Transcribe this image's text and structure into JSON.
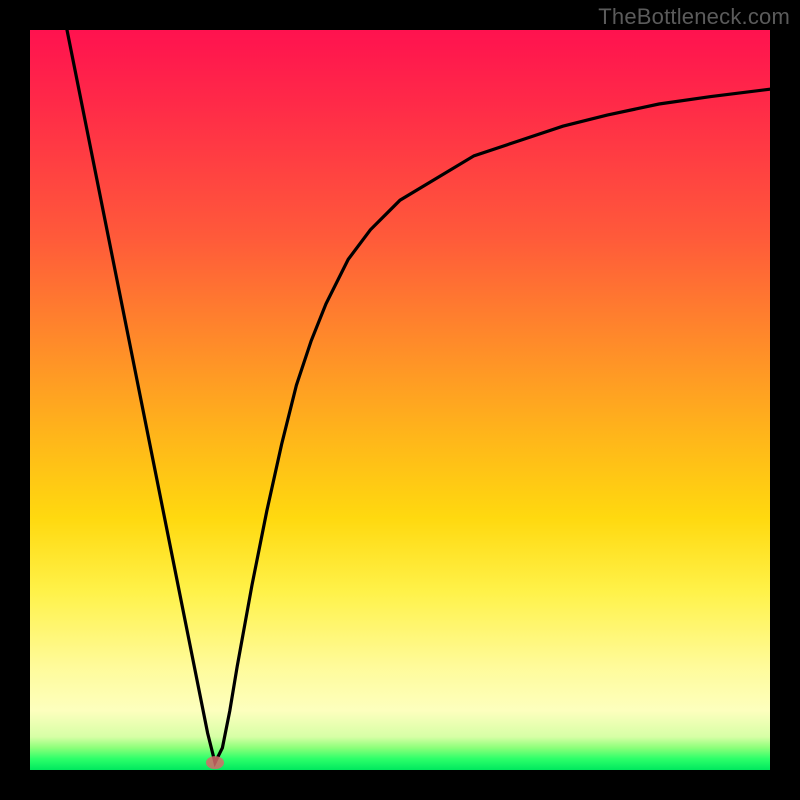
{
  "watermark": "TheBottleneck.com",
  "chart_data": {
    "type": "line",
    "title": "",
    "xlabel": "",
    "ylabel": "",
    "xlim": [
      0,
      100
    ],
    "ylim": [
      0,
      100
    ],
    "series": [
      {
        "name": "curve",
        "x": [
          5,
          7,
          9,
          11,
          13,
          15,
          17,
          19,
          21,
          23,
          24,
          25,
          26,
          27,
          28,
          30,
          32,
          34,
          36,
          38,
          40,
          43,
          46,
          50,
          55,
          60,
          66,
          72,
          78,
          85,
          92,
          100
        ],
        "values": [
          100,
          90,
          80,
          70,
          60,
          50,
          40,
          30,
          20,
          10,
          5,
          1,
          3,
          8,
          14,
          25,
          35,
          44,
          52,
          58,
          63,
          69,
          73,
          77,
          80,
          83,
          85,
          87,
          88.5,
          90,
          91,
          92
        ]
      }
    ],
    "marker": {
      "x": 25,
      "y": 1
    },
    "gradient_stops": [
      {
        "pos": 0,
        "color": "#ff124f"
      },
      {
        "pos": 50,
        "color": "#ffb61a"
      },
      {
        "pos": 92,
        "color": "#fdffbe"
      },
      {
        "pos": 100,
        "color": "#00e85e"
      }
    ]
  }
}
